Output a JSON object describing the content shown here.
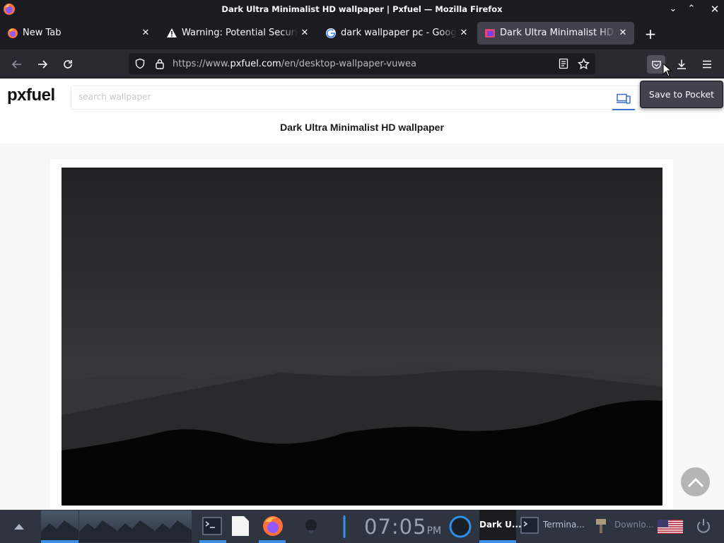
{
  "window": {
    "title": "Dark Ultra Minimalist HD wallpaper | Pxfuel — Mozilla Firefox"
  },
  "tabs": [
    {
      "label": "New Tab",
      "active": false
    },
    {
      "label": "Warning: Potential Security",
      "active": false
    },
    {
      "label": "dark wallpaper pc - Google",
      "active": false
    },
    {
      "label": "Dark Ultra Minimalist HD w",
      "active": true
    }
  ],
  "urlbar": {
    "prefix": "https://www.",
    "domain": "pxfuel.com",
    "path": "/en/desktop-wallpaper-vuwea"
  },
  "tooltip": {
    "text": "Save to Pocket"
  },
  "site": {
    "logo": "pxfuel",
    "search_placeholder": "search wallpaper",
    "page_title": "Dark Ultra Minimalist HD wallpaper"
  },
  "taskbar": {
    "clock_time": "07:05",
    "clock_ampm": "PM",
    "tasks": [
      {
        "label": "Dark U..."
      },
      {
        "label": "Termina..."
      },
      {
        "label": "Downlo..."
      }
    ]
  },
  "colors": {
    "accent": "#3d8ee8",
    "browser_chrome": "#1c1b22",
    "navbar": "#2b2a33",
    "taskbar": "#2e3440",
    "site_link_blue": "#3b6fd4"
  }
}
